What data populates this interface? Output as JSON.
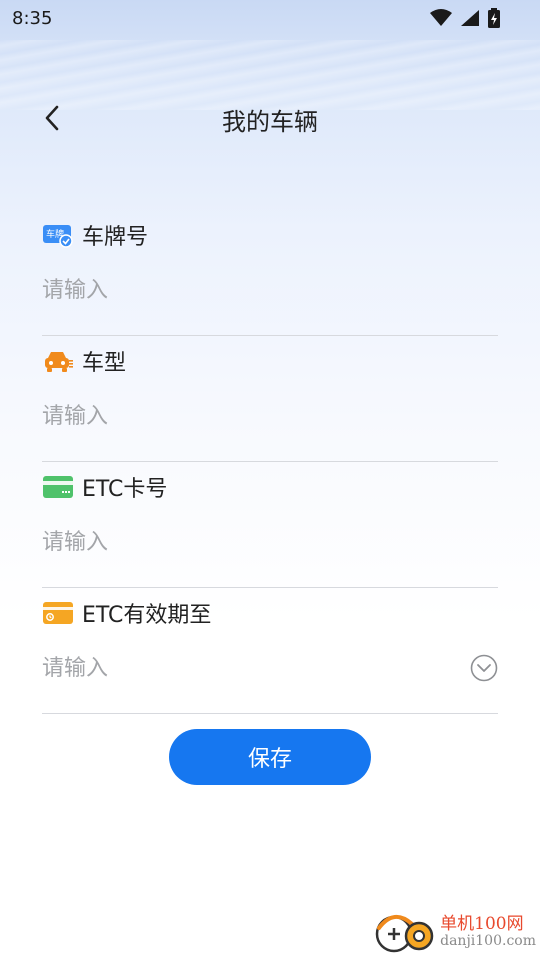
{
  "status_bar": {
    "time": "8:35"
  },
  "header": {
    "title": "我的车辆"
  },
  "form": {
    "fields": [
      {
        "label": "车牌号",
        "placeholder": "请输入",
        "icon": "license-plate-icon"
      },
      {
        "label": "车型",
        "placeholder": "请输入",
        "icon": "car-icon"
      },
      {
        "label": "ETC卡号",
        "placeholder": "请输入",
        "icon": "card-icon"
      },
      {
        "label": "ETC有效期至",
        "placeholder": "请输入",
        "icon": "calendar-card-icon"
      }
    ]
  },
  "actions": {
    "save_label": "保存"
  },
  "watermark": {
    "line1": "单机100网",
    "line2": "danji100.com"
  },
  "colors": {
    "primary": "#1677f0",
    "plate": "#3a8ef6",
    "car": "#f08a1c",
    "etc_card": "#4fc26b",
    "expiry_card": "#f5a623"
  }
}
